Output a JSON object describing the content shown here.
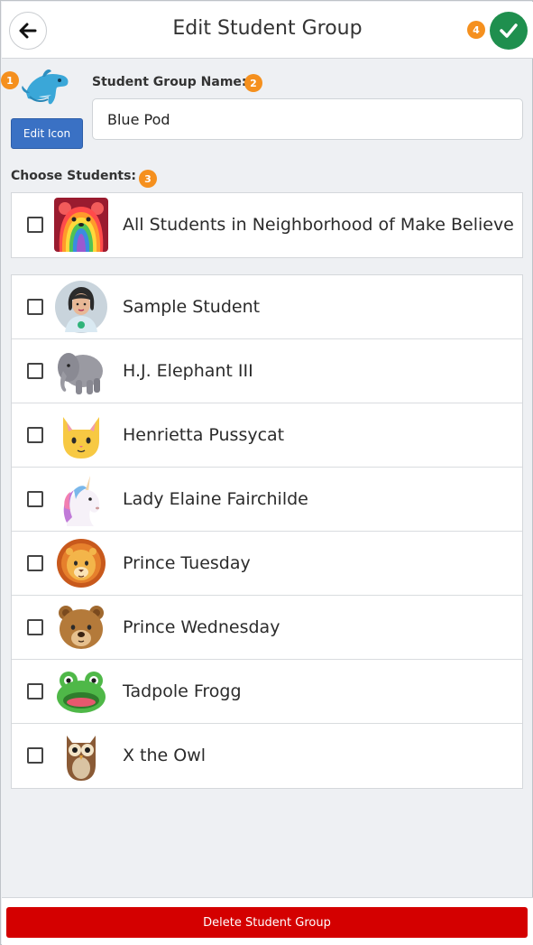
{
  "header": {
    "title": "Edit Student Group",
    "back_icon": "arrow-left-icon",
    "save_icon": "check-icon",
    "save_color": "#1f8f4e"
  },
  "badges": {
    "b1": "1",
    "b2": "2",
    "b3": "3",
    "b4": "4",
    "color": "#f5901e"
  },
  "group": {
    "icon": "dolphin-icon",
    "edit_icon_label": "Edit Icon",
    "name_label": "Student Group Name:",
    "name_value": "Blue Pod"
  },
  "students_section": {
    "label": "Choose Students:",
    "all_row": {
      "label": "All Students in Neighborhood of Make Believe",
      "icon": "rainbow-bear-icon",
      "checked": false
    },
    "students": [
      {
        "label": "Sample Student",
        "icon": "person-avatar-icon",
        "checked": false
      },
      {
        "label": "H.J. Elephant III",
        "icon": "elephant-icon",
        "checked": false
      },
      {
        "label": "Henrietta Pussycat",
        "icon": "cat-icon",
        "checked": false
      },
      {
        "label": "Lady Elaine Fairchilde",
        "icon": "unicorn-icon",
        "checked": false
      },
      {
        "label": "Prince Tuesday",
        "icon": "lion-icon",
        "checked": false
      },
      {
        "label": "Prince Wednesday",
        "icon": "bear-icon",
        "checked": false
      },
      {
        "label": "Tadpole Frogg",
        "icon": "frog-icon",
        "checked": false
      },
      {
        "label": "X the Owl",
        "icon": "owl-icon",
        "checked": false
      }
    ]
  },
  "footer": {
    "delete_label": "Delete Student Group",
    "delete_color": "#d40000"
  }
}
